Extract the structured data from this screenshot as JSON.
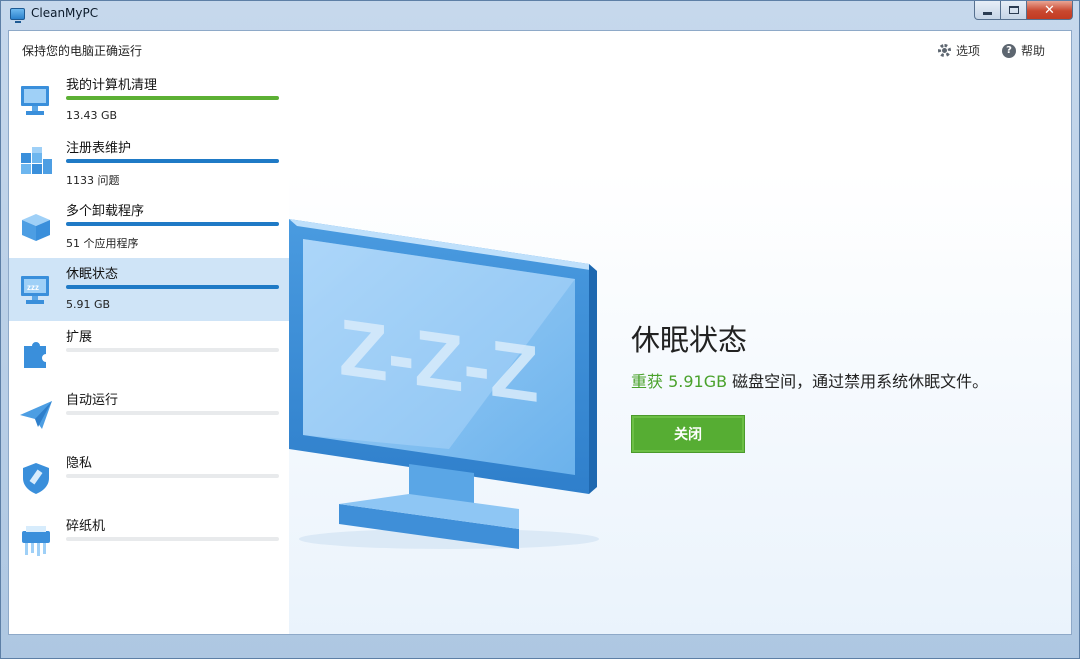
{
  "window": {
    "title": "CleanMyPC"
  },
  "topbar": {
    "tagline": "保持您的电脑正确运行",
    "options_label": "选项",
    "help_label": "帮助"
  },
  "sidebar": {
    "items": [
      {
        "label": "我的计算机清理",
        "sub": "13.43 GB",
        "progress": 1.0,
        "color": "#5cb034",
        "icon": "monitor-icon"
      },
      {
        "label": "注册表维护",
        "sub": "1133 问题",
        "progress": 1.0,
        "color": "#1f7ac6",
        "icon": "registry-cubes-icon"
      },
      {
        "label": "多个卸载程序",
        "sub": "51 个应用程序",
        "progress": 1.0,
        "color": "#1f7ac6",
        "icon": "box-icon"
      },
      {
        "label": "休眠状态",
        "sub": "5.91 GB",
        "progress": 1.0,
        "color": "#1f7ac6",
        "icon": "hibernation-icon",
        "active": true
      },
      {
        "label": "扩展",
        "sub": "",
        "progress": 0,
        "color": "#1f7ac6",
        "icon": "puzzle-icon"
      },
      {
        "label": "自动运行",
        "sub": "",
        "progress": 0,
        "color": "#1f7ac6",
        "icon": "paper-plane-icon"
      },
      {
        "label": "隐私",
        "sub": "",
        "progress": 0,
        "color": "#1f7ac6",
        "icon": "shield-brush-icon"
      },
      {
        "label": "碎纸机",
        "sub": "",
        "progress": 0,
        "color": "#1f7ac6",
        "icon": "shredder-icon"
      }
    ]
  },
  "main": {
    "title": "休眠状态",
    "desc_prefix": "重获 ",
    "desc_highlight": "5.91GB",
    "desc_suffix": " 磁盘空间，通过禁用系统休眠文件。",
    "action_label": "关闭",
    "illustration_text": "Z-Z-Z",
    "accent": "#56ad33"
  }
}
